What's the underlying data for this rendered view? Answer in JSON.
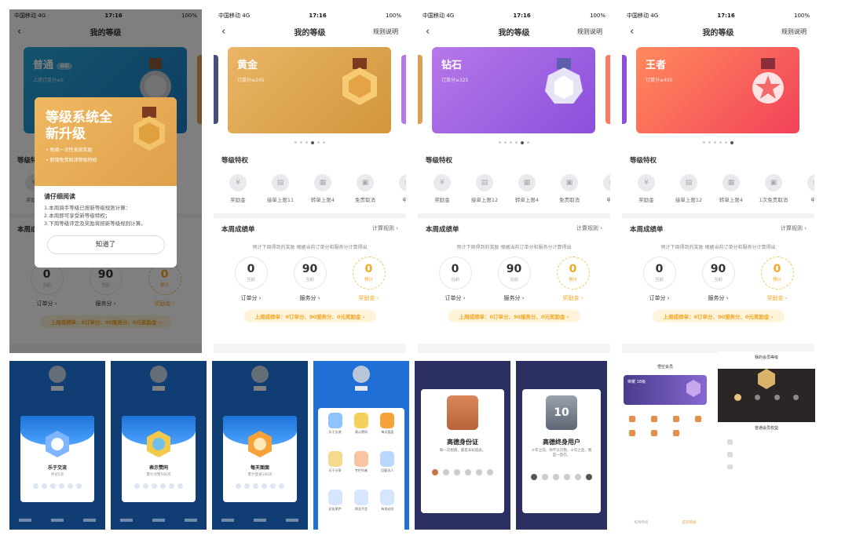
{
  "status": {
    "carrier1": "中国移动",
    "net1": "4G",
    "time1": "17:16",
    "battery1": "100%",
    "carrier2": "中国移动",
    "net2": "4G",
    "time2": "17:16",
    "battery2": "100%"
  },
  "nav": {
    "title": "我的等级",
    "back": "‹",
    "rules": "规则说明"
  },
  "screens": [
    {
      "level": "普通",
      "current": "当前",
      "score": "上周订单分≥0",
      "color_from": "#27a6d9",
      "color_to": "#1c7cc4"
    },
    {
      "level": "黄金",
      "score": "订单分≥245",
      "color_from": "#e9b566",
      "color_to": "#d2963c"
    },
    {
      "level": "钻石",
      "score": "订单分≥325",
      "color_from": "#b678e8",
      "color_to": "#8b4fdc"
    },
    {
      "level": "王者",
      "score": "订单分≥400",
      "color_from": "#ff8a5c",
      "color_to": "#f2425a"
    }
  ],
  "perks_title": "等级特权",
  "perks": {
    "s2": [
      "奖励金",
      "接单上限11",
      "转单上限4",
      "免责取消",
      "申诉"
    ],
    "s3": [
      "奖励金",
      "接单上限12",
      "转单上限4",
      "免责取消",
      "申诉"
    ],
    "s4": [
      "奖励金",
      "接单上限12",
      "转单上限4",
      "1次免责取消",
      "申诉"
    ]
  },
  "week": {
    "title": "本周成绩单",
    "rules_link": "计算规则 ›",
    "hint": "预计下周得到的奖励 根据当前订单分和服务分计算得出",
    "order": {
      "value": "0",
      "sub": "当前",
      "label": "订单分 ›"
    },
    "service": {
      "value": "90",
      "sub": "当前",
      "label": "服务分 ›"
    },
    "reward": {
      "value": "0",
      "sub": "预计",
      "label": "奖励金 ›"
    },
    "last_week": "上周成绩单：0订单分、90服务分、0元奖励金 ›"
  },
  "popup": {
    "title": "等级系统全新升级",
    "bullets": [
      "每周一次性发放奖励",
      "新增免责取消等级特权"
    ],
    "read_title": "请仔细阅读",
    "lines": [
      "1.本周骑手等级已按新等级规则计算：",
      "2.本周即可享受新等级特权；",
      "3.下周等级评定及奖励将按新等级规则计算。"
    ],
    "ok_button": "知道了"
  },
  "minis": {
    "badge1": {
      "title": "乐于交流",
      "sub": "评论5次"
    },
    "badge2": {
      "title": "表示赞同",
      "sub": "累计点赞500次"
    },
    "badge3": {
      "title": "每天面面",
      "sub": "累计登录100天"
    },
    "grid": [
      "乐于交流",
      "表示赞同",
      "每天面面",
      "乐于分享",
      "专栏作者",
      "回复达人",
      "初出茅庐",
      "知无不言",
      "有求必应"
    ],
    "gaode1": {
      "title": "高德身份证",
      "sub": "每一次相遇，都是未知旅途。"
    },
    "gaode2": {
      "title": "高德终身用户",
      "sub": "十年之前，你不认识我，十年之后，我是一直在。",
      "num": "10"
    },
    "vip_title": "悟空会员",
    "vip_level": "荣耀 18级",
    "vip_foot_left": "权限特权",
    "vip_foot_right": "提升等级",
    "member_title": "我的会员等级",
    "member_link": "普通会员权益"
  },
  "colors": {
    "gold": "#f5a623",
    "blue": "#1f6fd6",
    "purple": "#2b2f62"
  }
}
